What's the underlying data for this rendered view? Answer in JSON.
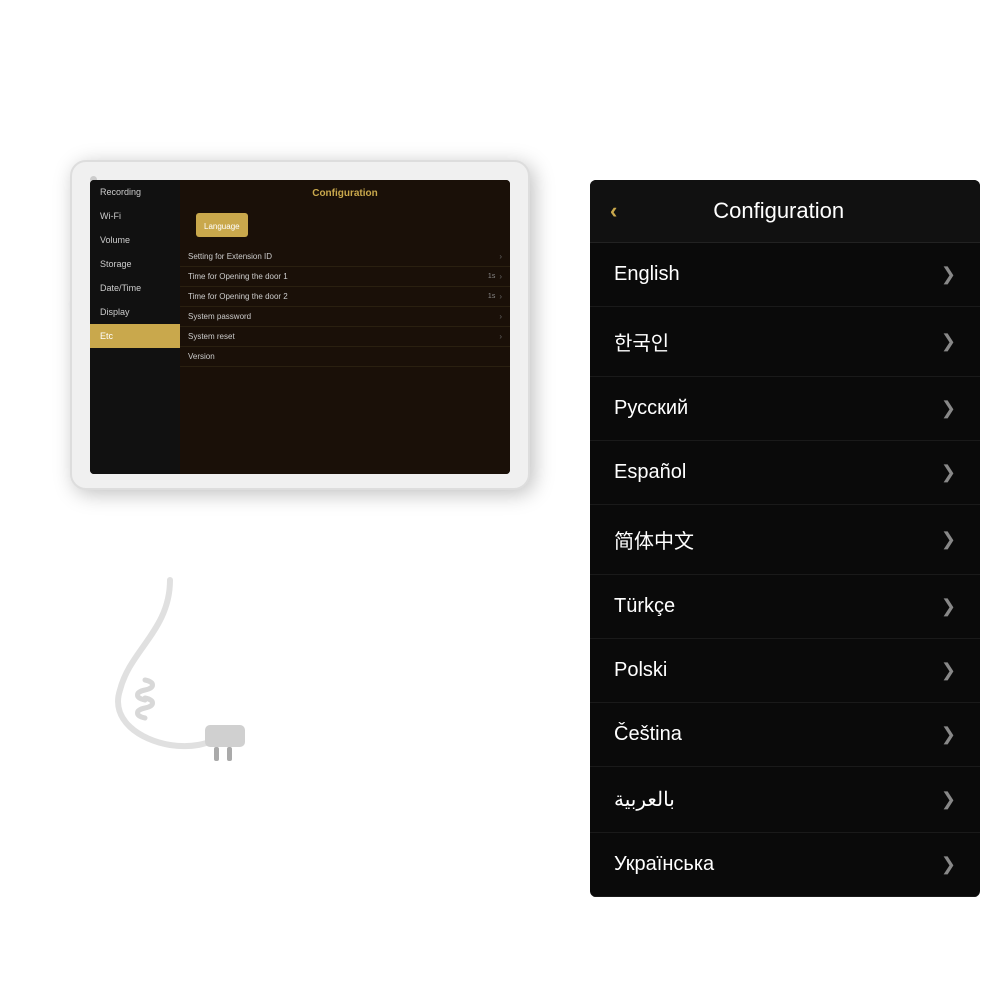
{
  "background": {
    "color": "#ffffff"
  },
  "tablet": {
    "sidebar_items": [
      {
        "label": "Recording",
        "active": false
      },
      {
        "label": "Wi-Fi",
        "active": false
      },
      {
        "label": "Volume",
        "active": false
      },
      {
        "label": "Storage",
        "active": false
      },
      {
        "label": "Date/Time",
        "active": false
      },
      {
        "label": "Display",
        "active": false
      },
      {
        "label": "Etc",
        "active": true
      }
    ],
    "screen_title": "Configuration",
    "screen_rows": [
      {
        "label": "Language",
        "value": "",
        "highlighted": true
      },
      {
        "label": "Setting for Extension ID",
        "value": "",
        "highlighted": false
      },
      {
        "label": "Time for Opening the door 1",
        "value": "1s",
        "highlighted": false
      },
      {
        "label": "Time for Opening the door 2",
        "value": "1s",
        "highlighted": false
      },
      {
        "label": "System  password",
        "value": "",
        "highlighted": false
      },
      {
        "label": "System reset",
        "value": "",
        "highlighted": false
      },
      {
        "label": "Version",
        "value": "",
        "highlighted": false
      }
    ]
  },
  "language_panel": {
    "title": "Configuration",
    "back_label": "‹",
    "languages": [
      {
        "name": "English"
      },
      {
        "name": "한국인"
      },
      {
        "name": "Русский"
      },
      {
        "name": "Español"
      },
      {
        "name": "简体中文"
      },
      {
        "name": "Türkçe"
      },
      {
        "name": "Polski"
      },
      {
        "name": "Čeština"
      },
      {
        "name": "بالعربية"
      },
      {
        "name": "Українська"
      }
    ]
  },
  "icons": {
    "back": "‹",
    "chevron_right": "›",
    "chevron_right_lang": "❯"
  }
}
